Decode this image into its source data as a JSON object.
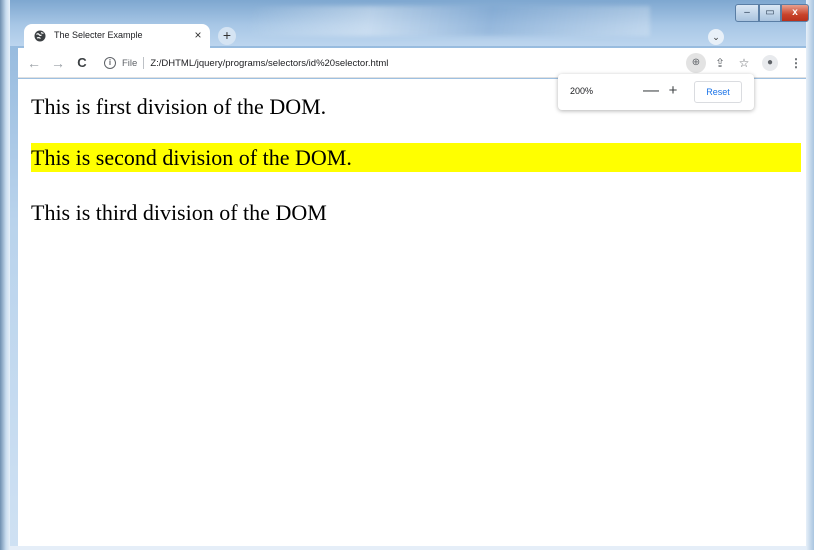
{
  "browser": {
    "tab": {
      "title": "The Selecter Example",
      "favicon": "globe-icon",
      "close_glyph": "×"
    },
    "new_tab_glyph": "+",
    "tab_search_glyph": "⌄",
    "window_controls": {
      "minimize": "–",
      "maximize": "▭",
      "close": "x"
    }
  },
  "toolbar": {
    "back_glyph": "←",
    "forward_glyph": "→",
    "reload_glyph": "C",
    "info_glyph": "i",
    "scheme_label": "File",
    "url": "Z:/DHTML/jquery/programs/selectors/id%20selector.html",
    "zoom_glyph": "⊕",
    "share_glyph": "⇪",
    "star_glyph": "☆",
    "profile_glyph": "●",
    "menu_glyph": "⋮"
  },
  "zoom_popup": {
    "level": "200%",
    "minus": "—",
    "plus": "+",
    "reset_label": "Reset"
  },
  "page": {
    "division1": "This is first division of the DOM.",
    "division2": "This is second division of the DOM.",
    "division3": "This is third division of the DOM",
    "highlight_color": "#ffff00"
  }
}
